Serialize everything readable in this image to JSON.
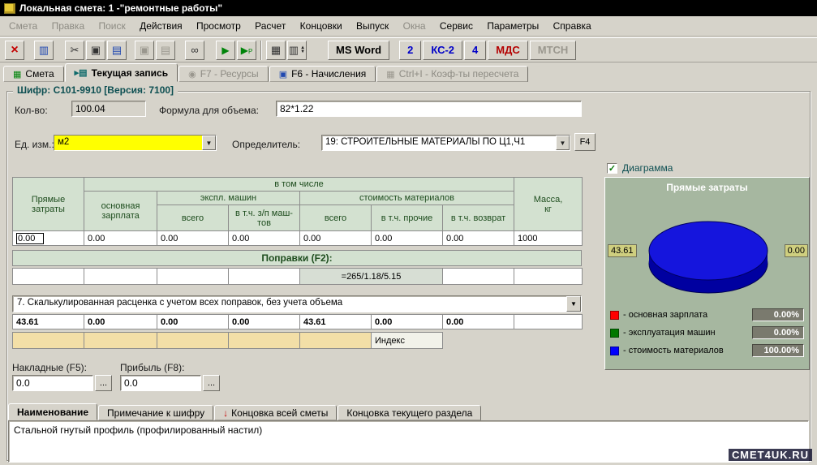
{
  "titlebar": {
    "title": "Локальная смета: 1 -\"ремонтные работы\""
  },
  "menu": {
    "items": [
      "Смета",
      "Правка",
      "Поиск",
      "Действия",
      "Просмотр",
      "Расчет",
      "Концовки",
      "Выпуск",
      "Окна",
      "Сервис",
      "Параметры",
      "Справка"
    ]
  },
  "toolbar": {
    "ms_word": "MS Word",
    "b2": "2",
    "ks2": "КС-2",
    "b4": "4",
    "mds": "МДС",
    "mtsn": "МТСН"
  },
  "tabs": {
    "smeta": "Смета",
    "current": "Текущая запись",
    "f7": "F7 - Ресурсы",
    "f6": "F6 - Начисления",
    "ctrl_i": "Ctrl+I - Коэф-ты пересчета"
  },
  "record": {
    "group_title": "Шифр: С101-9910  [Версия: 7100]",
    "qty_label": "Кол-во:",
    "qty": "100.04",
    "formula_label": "Формула для объема:",
    "formula": "82*1.22",
    "unit_label": "Ед. изм.:",
    "unit": "м2",
    "det_label": "Определитель:",
    "det": "19: СТРОИТЕЛЬНЫЕ МАТЕРИАЛЫ ПО Ц1,Ч1",
    "f4": "F4"
  },
  "grid": {
    "h_direct": "Прямые затраты",
    "h_incl": "в том числе",
    "h_mass": "Масса,\nкг",
    "h_salary": "основная зарплата",
    "h_mach": "экспл. машин",
    "h_mat": "стоимость материалов",
    "h_total": "всего",
    "h_zp": "в т.ч. з/п маш-тов",
    "h_total2": "всего",
    "h_other": "в т.ч. прочие",
    "h_return": "в т.ч. возврат",
    "row_base": [
      "0.00",
      "0.00",
      "0.00",
      "0.00",
      "0.00",
      "0.00",
      "0.00",
      "1000"
    ],
    "popravki_label": "Поправки (F2):",
    "popravka_formula": "=265/1.18/5.15",
    "calc_mode": "7. Скалькулированная расценка с учетом всех поправок, без учета объема",
    "row_calc": [
      "43.61",
      "0.00",
      "0.00",
      "0.00",
      "43.61",
      "0.00",
      "0.00"
    ],
    "index_label": "Индекс"
  },
  "footer_fields": {
    "overhead_label": "Накладные (F5):",
    "overhead": "0.0",
    "profit_label": "Прибыль (F8):",
    "profit": "0.0",
    "dots": "..."
  },
  "chart": {
    "checkbox_label": "Диаграмма",
    "title": "Прямые затраты",
    "left_value": "43.61",
    "right_value": "0.00",
    "legend": [
      {
        "label": "- основная зарплата",
        "value": "0.00%",
        "color": "#ff0000"
      },
      {
        "label": "- эксплуатация машин",
        "value": "0.00%",
        "color": "#007800"
      },
      {
        "label": "- стоимость материалов",
        "value": "100.00%",
        "color": "#0000ff"
      }
    ]
  },
  "chart_data": {
    "type": "pie",
    "title": "Прямые затраты",
    "labels": [
      "основная зарплата",
      "эксплуатация машин",
      "стоимость материалов"
    ],
    "values": [
      0,
      0,
      100
    ],
    "annotations": [
      "43.61",
      "0.00"
    ]
  },
  "bottom_tabs": {
    "name": "Наименование",
    "note": "Примечание к шифру",
    "end_all": "Концовка всей сметы",
    "end_section": "Концовка текущего раздела"
  },
  "description": "Стальной гнутый профиль (профилированный настил)",
  "watermark": "СМЕТ4UK.RU"
}
